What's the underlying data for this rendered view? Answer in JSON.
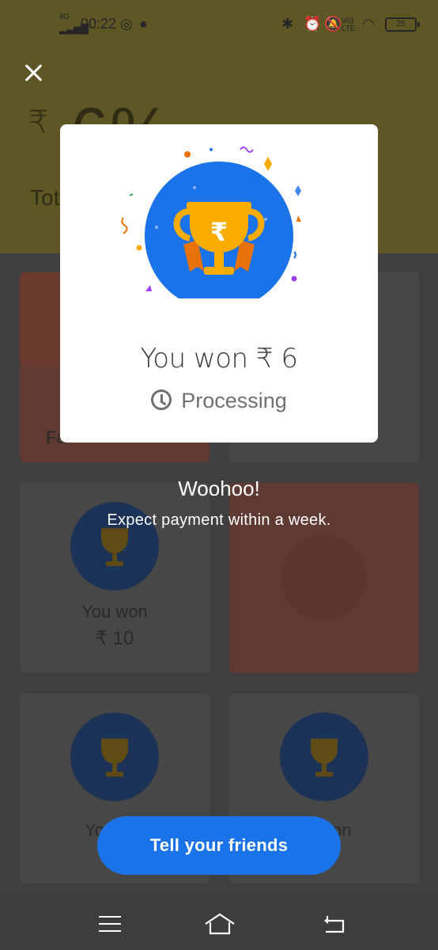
{
  "status_bar": {
    "network": "4G",
    "time": "00:22",
    "volte": "Vo) LTE",
    "battery": "25"
  },
  "background_page": {
    "amount_symbol": "₹",
    "amount_partial": "6%",
    "amount_label_partial": "Tot",
    "card_label_partial": "Fa",
    "card1_won_label": "You won",
    "card1_won_amount": "₹ 10",
    "card_bottom_left_partial": "Yo",
    "card_bottom_right_partial": "on"
  },
  "dialog": {
    "won_text": "You won ₹ 6",
    "status_text": "Processing"
  },
  "message": {
    "title": "Woohoo!",
    "subtitle": "Expect payment within a week."
  },
  "action": {
    "button_label": "Tell your friends"
  },
  "icons": {
    "close": "close-icon",
    "trophy": "trophy-icon",
    "clock": "clock-icon",
    "menu": "menu-icon",
    "home": "home-icon",
    "back": "back-icon"
  },
  "colors": {
    "primary_button": "#1a73e8",
    "trophy_circle": "#1a73e8",
    "trophy_gold": "#f9ab00",
    "ribbon": "#e8710a"
  }
}
